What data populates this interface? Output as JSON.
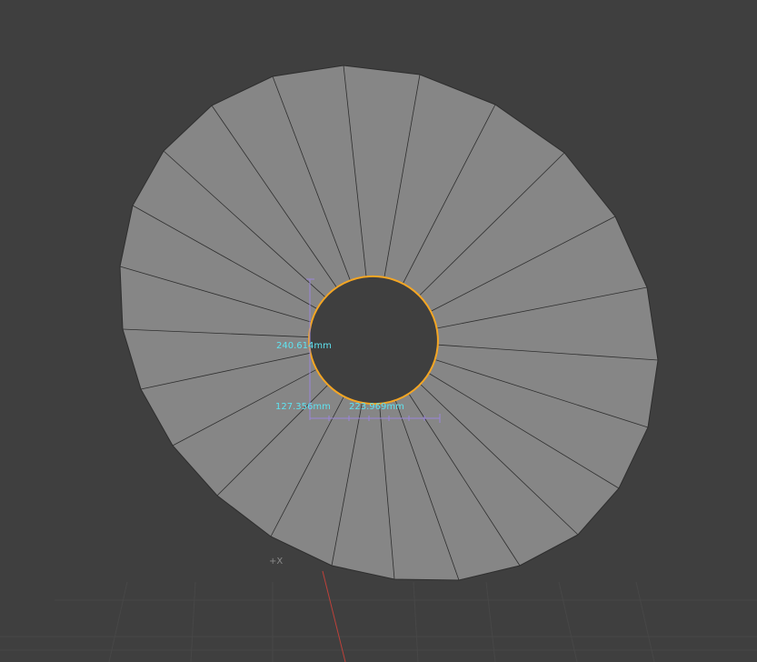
{
  "viewport": {
    "axis_label": "+X",
    "colors": {
      "background": "#3f3f3f",
      "grid": "#4a4a4a",
      "face": "#868686",
      "edge": "#2e2e2e",
      "selection": "#f5a623",
      "measure_text": "#5fe3f0",
      "measure_lines": "#9a86d8",
      "x_axis": "#c0413a"
    }
  },
  "measurements": {
    "height": "240.614mm",
    "depth": "127.356mm",
    "width": "223.969mm"
  }
}
